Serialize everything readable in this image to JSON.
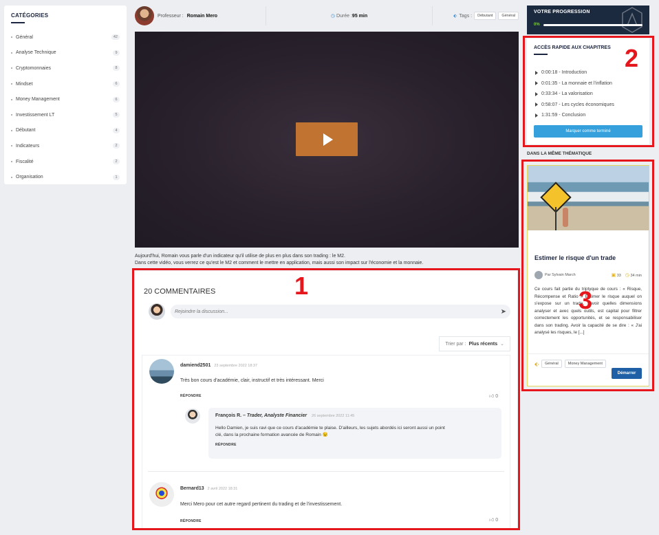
{
  "categories": {
    "title": "CATÉGORIES",
    "items": [
      {
        "label": "Général",
        "count": "42"
      },
      {
        "label": "Analyse Technique",
        "count": "9"
      },
      {
        "label": "Cryptomonnaies",
        "count": "8"
      },
      {
        "label": "Mindset",
        "count": "6"
      },
      {
        "label": "Money Management",
        "count": "6"
      },
      {
        "label": "Investissement LT",
        "count": "5"
      },
      {
        "label": "Débutant",
        "count": "4"
      },
      {
        "label": "Indicateurs",
        "count": "2"
      },
      {
        "label": "Fiscalité",
        "count": "2"
      },
      {
        "label": "Organisation",
        "count": "1"
      }
    ]
  },
  "header": {
    "prof_label": "Professeur :",
    "prof_name": "Romain Mero",
    "duration_label": "Durée :",
    "duration_value": "95 min",
    "tags_label": "Tags :",
    "tags": [
      "Débutant",
      "Général"
    ]
  },
  "video": {
    "description_line1": "Aujourd'hui, Romain vous parle d'un indicateur qu'il utilise de plus en plus dans son trading : le M2.",
    "description_line2": "Dans cette vidéo, vous verrez ce qu'est le M2 et comment le mettre en application, mais aussi son impact sur l'économie et la monnaie."
  },
  "comments": {
    "title": "20 COMMENTAIRES",
    "input_placeholder": "Rejoindre la discussion...",
    "sort_label": "Trier par :",
    "sort_value": "Plus récents",
    "items": [
      {
        "author": "damiend2501",
        "date": "23 septembre 2022 18:37",
        "text": "Très bon cours d'académie, clair, instructif et très intéressant. Merci",
        "reply_label": "RÉPONDRE",
        "likes": "0"
      },
      {
        "author": "Bernard13",
        "date": "2 avril 2022 18:31",
        "text": "Merci Mero pour cet autre regard pertinent du trading et de l'investissement.",
        "reply_label": "RÉPONDRE",
        "likes": "0"
      }
    ],
    "reply": {
      "author": "François R. –",
      "role": "Trader, Analyste Financier",
      "date": "26 septembre 2022 11:45",
      "text_line1": "Hello Damien, je suis ravi que ce cours d'académie te plaise. D'ailleurs, les sujets abordés ici seront aussi un point",
      "text_line2": "clé, dans la prochaine formation avancée de Romain 😉",
      "reply_label": "RÉPONDRE"
    }
  },
  "progress": {
    "title": "VOTRE PROGRESSION",
    "percent": "0%",
    "value": 0
  },
  "chapters": {
    "title": "ACCÈS RAPIDE AUX CHAPITRES",
    "items": [
      "0:00:18 - Introduction",
      "0:01:35 - La monnaie et l'inflation",
      "0:33:34 - La valorisation",
      "0:58:07 - Les cycles économiques",
      "1:31:59 - Conclusion"
    ],
    "button": "Marquer comme terminé"
  },
  "related": {
    "section_title": "DANS LA MÊME THÉMATIQUE",
    "card_title": "Estimer le risque d'un trade",
    "author": "Par Sylvain March",
    "comments": "33",
    "duration": "34 min",
    "excerpt": "Ce cours fait partie du triptyque de cours : « Risque, Récompense et Ratio » Estimer le risque auquel on s'expose sur un trade, savoir quelles dimensions analyser et avec quels outils, est capital pour filtrer correctement les opportunités, et se responsabiliser dans son trading. Avoir la capacité de se dire : « J'ai analysé les risques, le [...]",
    "tags": [
      "Général",
      "Money Management"
    ],
    "button": "Démarrer"
  },
  "annotations": [
    "1",
    "2",
    "3"
  ],
  "colors": {
    "annotation": "#e5161c",
    "play_button": "#c17431",
    "accent_blue": "#36a0dc",
    "navy": "#1c2a3f"
  }
}
